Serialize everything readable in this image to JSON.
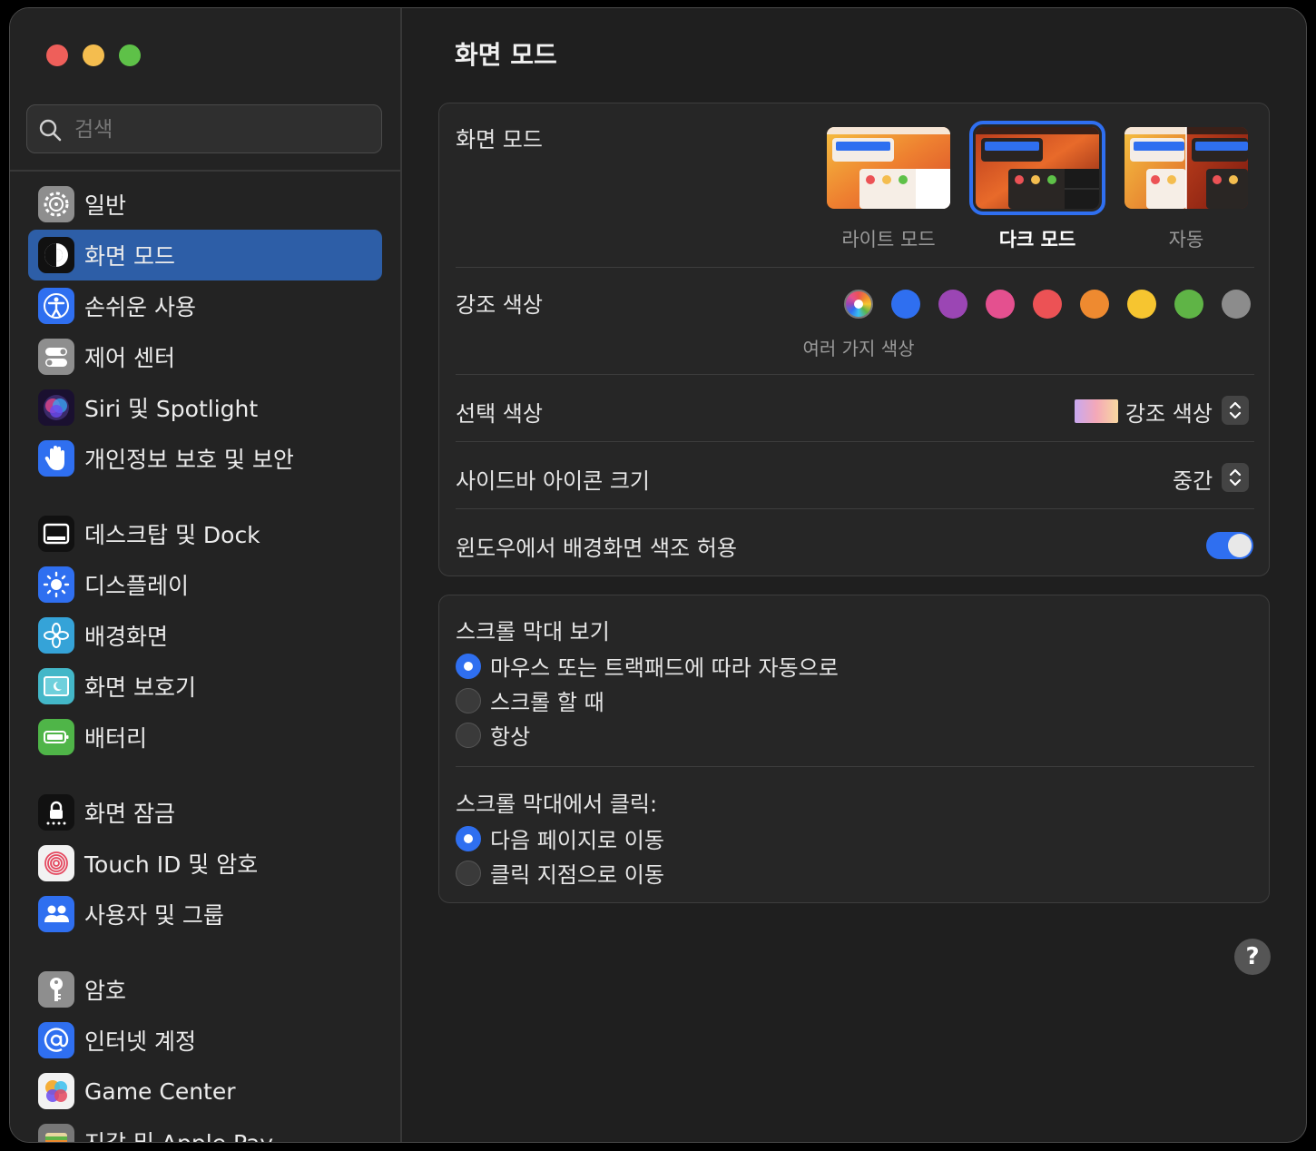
{
  "window": {
    "title": "화면 모드",
    "traffic_lights": [
      "close",
      "minimize",
      "zoom"
    ]
  },
  "search": {
    "placeholder": "검색"
  },
  "sidebar": {
    "items": [
      {
        "label": "일반",
        "icon": "gear-icon"
      },
      {
        "label": "화면 모드",
        "icon": "appearance-icon",
        "selected": true
      },
      {
        "label": "손쉬운 사용",
        "icon": "accessibility-icon"
      },
      {
        "label": "제어 센터",
        "icon": "control-center-icon"
      },
      {
        "label": "Siri 및 Spotlight",
        "icon": "siri-icon"
      },
      {
        "label": "개인정보 보호 및 보안",
        "icon": "hand-icon"
      },
      {
        "label": "데스크탑 및 Dock",
        "icon": "dock-icon"
      },
      {
        "label": "디스플레이",
        "icon": "display-brightness-icon"
      },
      {
        "label": "배경화면",
        "icon": "wallpaper-flower-icon"
      },
      {
        "label": "화면 보호기",
        "icon": "screensaver-icon"
      },
      {
        "label": "배터리",
        "icon": "battery-icon"
      },
      {
        "label": "화면 잠금",
        "icon": "lock-icon"
      },
      {
        "label": "Touch ID 및 암호",
        "icon": "fingerprint-icon"
      },
      {
        "label": "사용자 및 그룹",
        "icon": "users-icon"
      },
      {
        "label": "암호",
        "icon": "key-icon"
      },
      {
        "label": "인터넷 계정",
        "icon": "at-icon"
      },
      {
        "label": "Game Center",
        "icon": "game-center-icon"
      },
      {
        "label": "지갑 및 Apple Pay",
        "icon": "wallet-icon"
      }
    ]
  },
  "appearance": {
    "label": "화면 모드",
    "options": [
      {
        "label": "라이트 모드",
        "selected": false
      },
      {
        "label": "다크 모드",
        "selected": true
      },
      {
        "label": "자동",
        "selected": false
      }
    ]
  },
  "accent": {
    "label": "강조 색상",
    "selected_caption": "여러 가지 색상",
    "colors": [
      "multicolor",
      "#2f6ff0",
      "#9b46b4",
      "#e4508f",
      "#ec5255",
      "#ee8a30",
      "#f6c530",
      "#5fb446",
      "#8c8c8c"
    ]
  },
  "highlight": {
    "label": "선택 색상",
    "value": "강조 색상"
  },
  "sidebar_icon_size": {
    "label": "사이드바 아이콘 크기",
    "value": "중간"
  },
  "wallpaper_tinting": {
    "label": "윈도우에서 배경화면 색조 허용",
    "enabled": true
  },
  "scrollbars": {
    "show_label": "스크롤 막대 보기",
    "show_options": [
      {
        "label": "마우스 또는 트랙패드에 따라 자동으로",
        "selected": true
      },
      {
        "label": "스크롤 할 때",
        "selected": false
      },
      {
        "label": "항상",
        "selected": false
      }
    ],
    "click_label": "스크롤 막대에서 클릭:",
    "click_options": [
      {
        "label": "다음 페이지로 이동",
        "selected": true
      },
      {
        "label": "클릭 지점으로 이동",
        "selected": false
      }
    ]
  },
  "help": {
    "label": "?"
  }
}
